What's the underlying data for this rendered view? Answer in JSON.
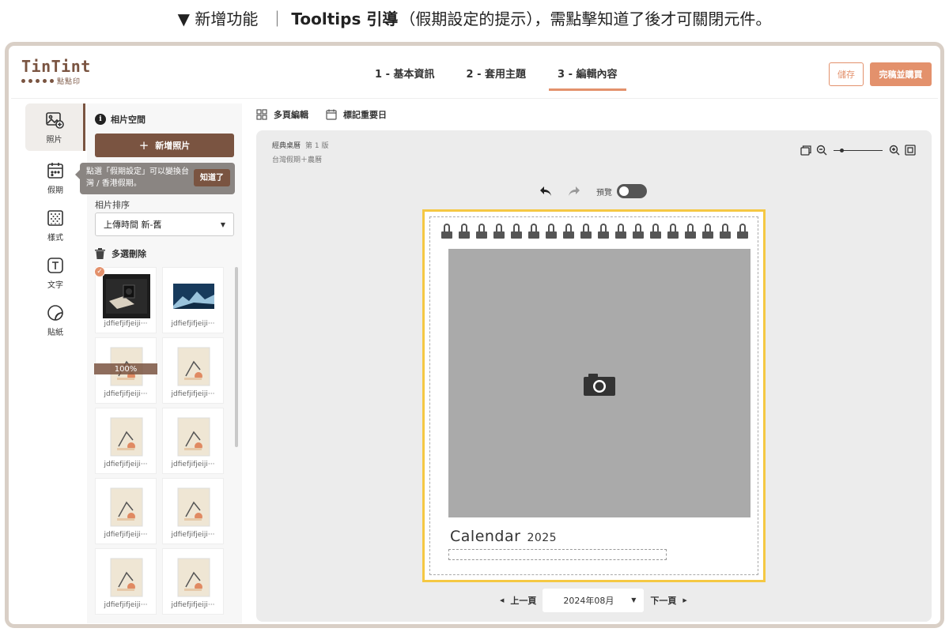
{
  "caption": {
    "prefix": "▼ 新增功能",
    "separator": "｜",
    "title": "Tooltips 引導",
    "rest": "（假期設定的提示），需點擊知道了後才可關閉元件。"
  },
  "header": {
    "logo_main": "TinTint",
    "logo_sub": "點點印",
    "steps": [
      "1 - 基本資訊",
      "2 - 套用主題",
      "3 - 編輯內容"
    ],
    "active_step": 2,
    "save_label": "儲存",
    "finish_label": "完稿並購買"
  },
  "sidebar": {
    "items": [
      {
        "label": "照片",
        "icon": "photo-add-icon"
      },
      {
        "label": "假期",
        "icon": "calendar-icon"
      },
      {
        "label": "樣式",
        "icon": "pattern-icon"
      },
      {
        "label": "文字",
        "icon": "text-icon"
      },
      {
        "label": "貼紙",
        "icon": "sticker-icon"
      }
    ],
    "active": 0
  },
  "panel": {
    "title": "相片空間",
    "add_photo_label": "新增照片",
    "sort_label": "相片排序",
    "sort_value": "上傳時間 新-舊",
    "multi_delete_label": "多選刪除",
    "photos": [
      {
        "name": "jdfiefjifjeiji···",
        "selected": true
      },
      {
        "name": "jdfiefjifjeiji···"
      },
      {
        "name": "jdfiefjifjeiji···",
        "progress": "100%"
      },
      {
        "name": "jdfiefjifjeiji···"
      },
      {
        "name": "jdfiefjifjeiji···"
      },
      {
        "name": "jdfiefjifjeiji···"
      },
      {
        "name": "jdfiefjifjeiji···"
      },
      {
        "name": "jdfiefjifjeiji···"
      },
      {
        "name": "jdfiefjifjeiji···"
      },
      {
        "name": "jdfiefjifjeiji···"
      }
    ]
  },
  "tooltip": {
    "text": "點選「假期設定」可以變換台灣 / 香港假期。",
    "button": "知道了"
  },
  "toolbar": {
    "multi_page_label": "多頁編輯",
    "mark_date_label": "標記重要日"
  },
  "canvas": {
    "template_name": "經典桌曆",
    "version": "第 1 版",
    "holiday_setting": "台灣假期＋農曆",
    "preview_label": "預覽",
    "calendar_title": "Calendar",
    "calendar_year": "2025",
    "ring_count": 18
  },
  "pager": {
    "prev_label": "上一頁",
    "next_label": "下一頁",
    "month_value": "2024年08月"
  },
  "colors": {
    "brand_brown": "#7a5441",
    "accent_orange": "#e3916c",
    "page_border_yellow": "#f5c843",
    "photo_slot_gray": "#aaaaaa"
  }
}
